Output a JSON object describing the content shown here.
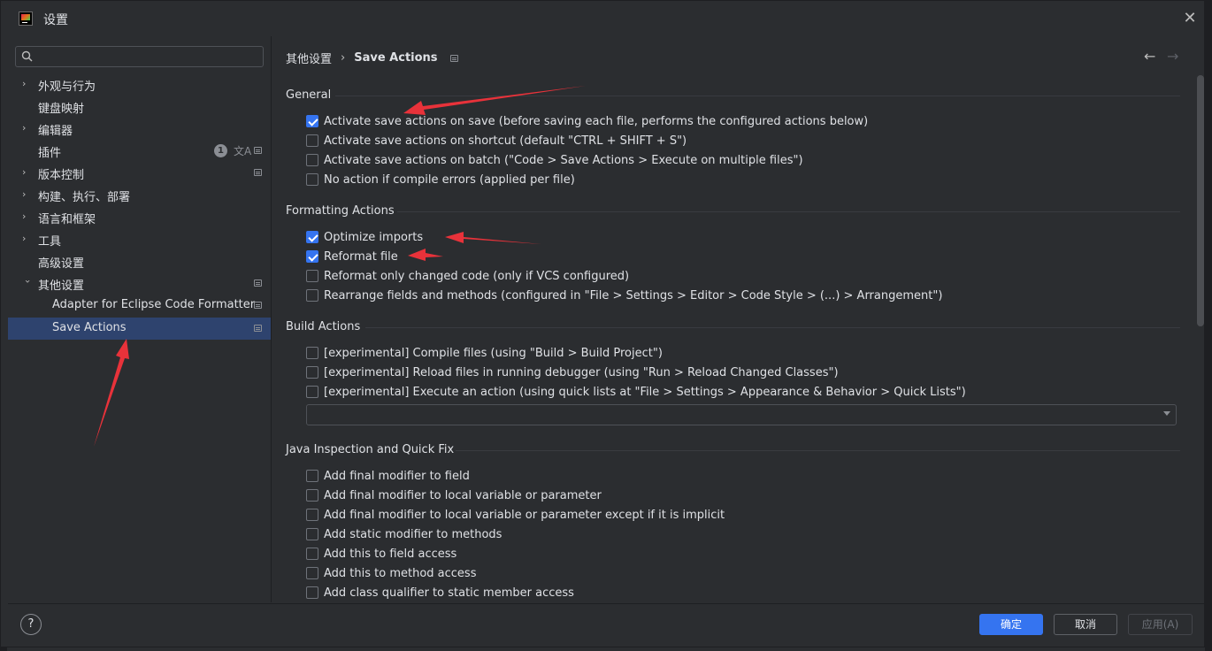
{
  "window": {
    "title": "设置"
  },
  "search": {
    "placeholder": ""
  },
  "sidebar": {
    "items": [
      {
        "label": "外观与行为"
      },
      {
        "label": "键盘映射"
      },
      {
        "label": "编辑器"
      },
      {
        "label": "插件",
        "badge": "1"
      },
      {
        "label": "版本控制"
      },
      {
        "label": "构建、执行、部署"
      },
      {
        "label": "语言和框架"
      },
      {
        "label": "工具"
      },
      {
        "label": "高级设置"
      },
      {
        "label": "其他设置"
      },
      {
        "label": "Adapter for Eclipse Code Formatter"
      },
      {
        "label": "Save Actions"
      }
    ]
  },
  "breadcrumb": {
    "parent": "其他设置",
    "separator": "›",
    "current": "Save Actions"
  },
  "nav": {
    "back": "←",
    "forward": "→"
  },
  "sections": {
    "general": {
      "title": "General",
      "options": [
        {
          "label": "Activate save actions on save (before saving each file, performs the configured actions below)",
          "checked": true
        },
        {
          "label": "Activate save actions on shortcut (default \"CTRL + SHIFT + S\")",
          "checked": false
        },
        {
          "label": "Activate save actions on batch (\"Code > Save Actions > Execute on multiple files\")",
          "checked": false
        },
        {
          "label": "No action if compile errors (applied per file)",
          "checked": false
        }
      ]
    },
    "formatting": {
      "title": "Formatting Actions",
      "options": [
        {
          "label": "Optimize imports",
          "checked": true
        },
        {
          "label": "Reformat file",
          "checked": true
        },
        {
          "label": "Reformat only changed code (only if VCS configured)",
          "checked": false
        },
        {
          "label": "Rearrange fields and methods (configured in \"File > Settings > Editor > Code Style > (...) > Arrangement\")",
          "checked": false
        }
      ]
    },
    "build": {
      "title": "Build Actions",
      "options": [
        {
          "label": "[experimental] Compile files (using \"Build > Build Project\")",
          "checked": false
        },
        {
          "label": "[experimental] Reload files in running debugger (using \"Run > Reload Changed Classes\")",
          "checked": false
        },
        {
          "label": "[experimental] Execute an action (using quick lists at \"File > Settings > Appearance & Behavior > Quick Lists\")",
          "checked": false
        }
      ],
      "quick_list_value": ""
    },
    "java": {
      "title": "Java Inspection and Quick Fix",
      "options": [
        {
          "label": "Add final modifier to field",
          "checked": false
        },
        {
          "label": "Add final modifier to local variable or parameter",
          "checked": false
        },
        {
          "label": "Add final modifier to local variable or parameter except if it is implicit",
          "checked": false
        },
        {
          "label": "Add static modifier to methods",
          "checked": false
        },
        {
          "label": "Add this to field access",
          "checked": false
        },
        {
          "label": "Add this to method access",
          "checked": false
        },
        {
          "label": "Add class qualifier to static member access",
          "checked": false
        }
      ]
    }
  },
  "footer": {
    "help": "?",
    "ok": "确定",
    "cancel": "取消",
    "apply": "应用(A)"
  },
  "colors": {
    "accent": "#3574f0",
    "selected_row": "#2e436e",
    "annotation_arrow": "#e8323a"
  }
}
